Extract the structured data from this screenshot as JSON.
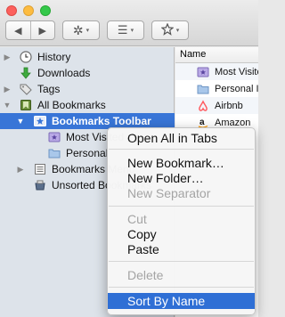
{
  "toolbar": {
    "back_glyph": "◀",
    "forward_glyph": "▶",
    "organize_glyph": "✲",
    "views_glyph": "☰",
    "import_glyph": "⎘",
    "caret_glyph": "▾"
  },
  "sidebar": {
    "items": [
      {
        "label": "History"
      },
      {
        "label": "Downloads"
      },
      {
        "label": "Tags"
      },
      {
        "label": "All Bookmarks"
      },
      {
        "label": "Bookmarks Toolbar"
      },
      {
        "label": "Most Visited"
      },
      {
        "label": "Personal"
      },
      {
        "label": "Bookmarks Menu"
      },
      {
        "label": "Unsorted Bookmarks"
      }
    ]
  },
  "content": {
    "column_header": "Name",
    "rows": [
      {
        "label": "Most Visited"
      },
      {
        "label": "Personal Information"
      },
      {
        "label": "Airbnb"
      },
      {
        "label": "Amazon"
      }
    ]
  },
  "context_menu": {
    "items": [
      {
        "label": "Open All in Tabs",
        "enabled": true
      },
      {
        "label": "New Bookmark…",
        "enabled": true
      },
      {
        "label": "New Folder…",
        "enabled": true
      },
      {
        "label": "New Separator",
        "enabled": false
      },
      {
        "label": "Cut",
        "enabled": false
      },
      {
        "label": "Copy",
        "enabled": true
      },
      {
        "label": "Paste",
        "enabled": true
      },
      {
        "label": "Delete",
        "enabled": false
      },
      {
        "label": "Sort By Name",
        "enabled": true,
        "highlighted": true
      }
    ]
  },
  "colors": {
    "selection": "#3875d7",
    "menu_highlight": "#2f6fd5",
    "airbnb": "#ff5a5f",
    "amazon_arrow": "#ff9900"
  }
}
